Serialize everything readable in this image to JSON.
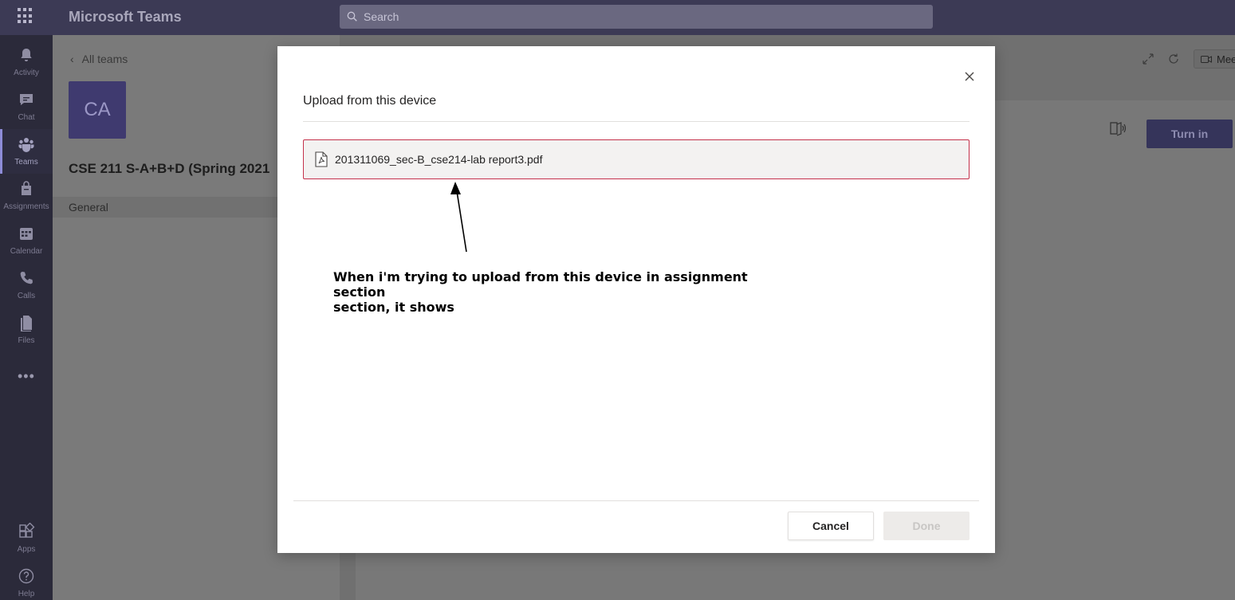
{
  "app": {
    "title": "Microsoft Teams"
  },
  "search": {
    "placeholder": "Search"
  },
  "rail": {
    "items": [
      {
        "label": "Activity",
        "icon": "bell-icon"
      },
      {
        "label": "Chat",
        "icon": "chat-icon"
      },
      {
        "label": "Teams",
        "icon": "teams-icon",
        "active": true
      },
      {
        "label": "Assignments",
        "icon": "assignments-icon"
      },
      {
        "label": "Calendar",
        "icon": "calendar-icon"
      },
      {
        "label": "Calls",
        "icon": "phone-icon"
      },
      {
        "label": "Files",
        "icon": "files-icon"
      }
    ],
    "more": "•••",
    "bottom": [
      {
        "label": "Apps",
        "icon": "apps-icon"
      },
      {
        "label": "Help",
        "icon": "help-icon"
      }
    ]
  },
  "team_panel": {
    "back_label": "All teams",
    "avatar_initials": "CA",
    "team_name": "CSE 211 S-A+B+D (Spring 2021",
    "channel": "General"
  },
  "content": {
    "meet_label": "Mee",
    "turn_in_label": "Turn in"
  },
  "modal": {
    "title": "Upload from this device",
    "file_name": "201311069_sec-B_cse214-lab report3.pdf",
    "annotation_line1": "When i'm trying to upload from this device in assignment section",
    "annotation_line2": "section, it shows",
    "cancel_label": "Cancel",
    "done_label": "Done"
  },
  "colors": {
    "topbar": "#3c3a55",
    "rail": "#2b2a3a",
    "file_border": "#c4314b",
    "accent": "#8e8cd8"
  }
}
